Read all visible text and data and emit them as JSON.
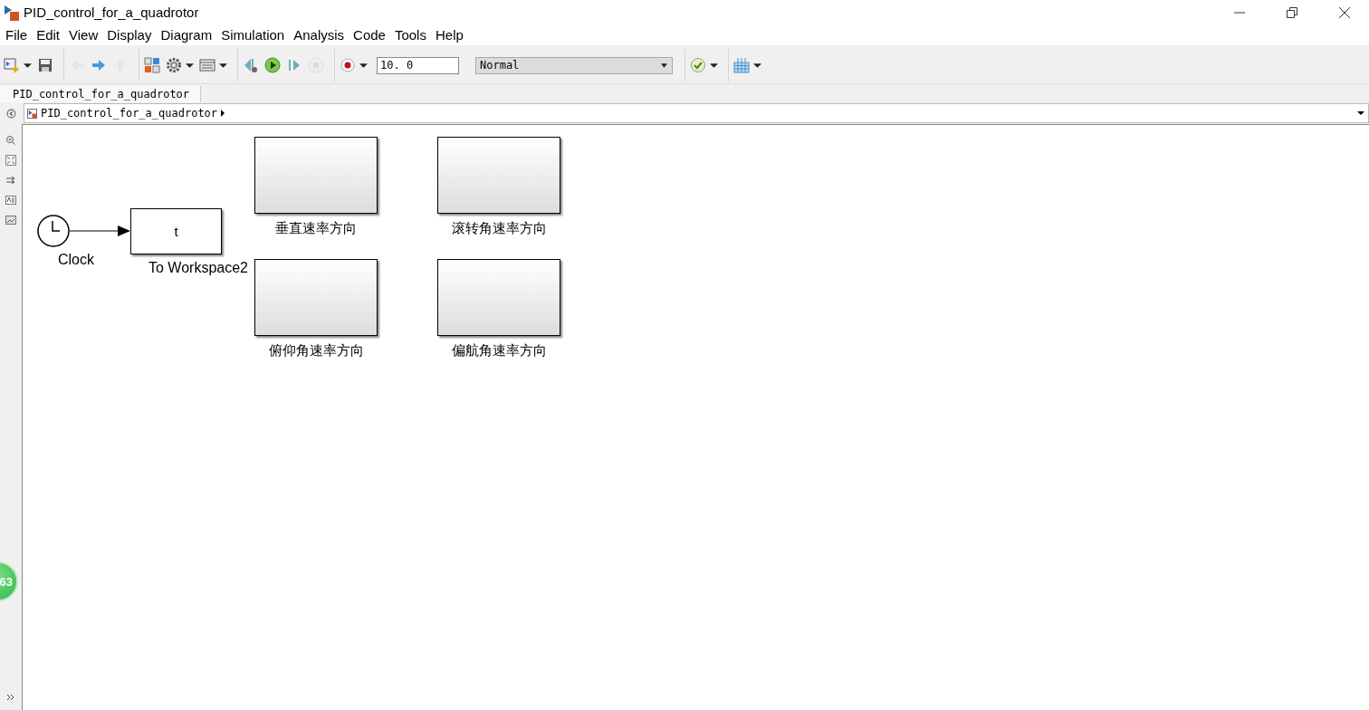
{
  "window": {
    "title": "PID_control_for_a_quadrotor"
  },
  "menu": [
    "File",
    "Edit",
    "View",
    "Display",
    "Diagram",
    "Simulation",
    "Analysis",
    "Code",
    "Tools",
    "Help"
  ],
  "toolbar": [
    {
      "kind": "new-model",
      "disabled": false,
      "dropdown": true
    },
    {
      "kind": "save",
      "disabled": false,
      "dropdown": false
    },
    {
      "kind": "sep"
    },
    {
      "kind": "back",
      "disabled": true,
      "dropdown": false
    },
    {
      "kind": "forward",
      "disabled": false,
      "dropdown": false
    },
    {
      "kind": "up",
      "disabled": true,
      "dropdown": false
    },
    {
      "kind": "sep"
    },
    {
      "kind": "library",
      "disabled": false,
      "dropdown": false
    },
    {
      "kind": "gear",
      "disabled": false,
      "dropdown": true
    },
    {
      "kind": "explorer",
      "disabled": false,
      "dropdown": true
    },
    {
      "kind": "sep"
    },
    {
      "kind": "step-back",
      "disabled": false,
      "dropdown": false
    },
    {
      "kind": "run",
      "disabled": false,
      "dropdown": false
    },
    {
      "kind": "step-forward",
      "disabled": false,
      "dropdown": false
    },
    {
      "kind": "stop",
      "disabled": true,
      "dropdown": false
    },
    {
      "kind": "sep"
    },
    {
      "kind": "record",
      "disabled": false,
      "dropdown": true
    },
    {
      "kind": "stop-time",
      "value": "10. 0"
    },
    {
      "kind": "mode",
      "value": "Normal"
    },
    {
      "kind": "sep"
    },
    {
      "kind": "check",
      "disabled": false,
      "dropdown": true
    },
    {
      "kind": "sep"
    },
    {
      "kind": "grid",
      "disabled": false,
      "dropdown": true
    }
  ],
  "tabs": [
    {
      "label": "PID_control_for_a_quadrotor",
      "selected": true
    }
  ],
  "breadcrumb": "PID_control_for_a_quadrotor",
  "blocks": [
    {
      "kind": "clock",
      "label": "Clock"
    },
    {
      "kind": "to_workspace",
      "text": "t",
      "label": "To Workspace2"
    },
    {
      "kind": "scope",
      "label": "垂直速率方向"
    },
    {
      "kind": "scope",
      "label": "滚转角速率方向"
    },
    {
      "kind": "scope",
      "label": "俯仰角速率方向"
    },
    {
      "kind": "scope",
      "label": "偏航角速率方向"
    }
  ],
  "floating_badge": "63"
}
